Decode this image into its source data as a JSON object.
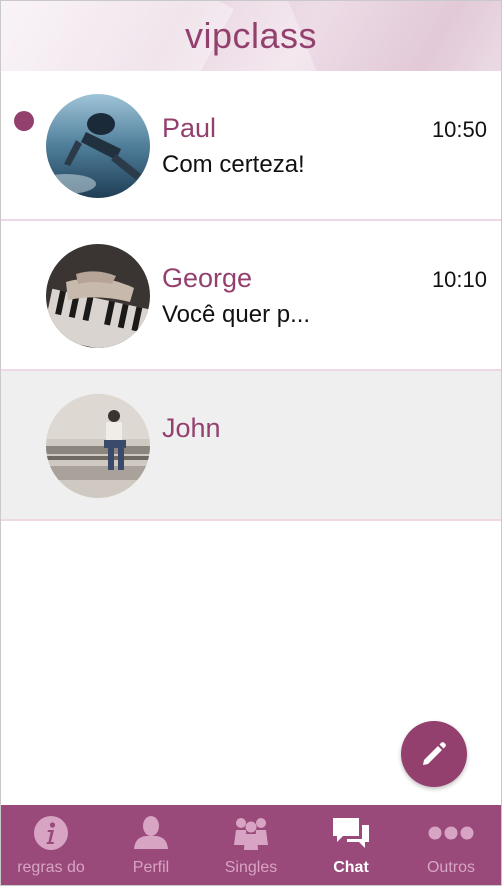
{
  "app": {
    "title": "vipclass"
  },
  "conversations": [
    {
      "name": "Paul",
      "time": "10:50",
      "message": "Com certeza!",
      "unread": true
    },
    {
      "name": "George",
      "time": "10:10",
      "message": "Você quer p...",
      "unread": false
    },
    {
      "name": "John",
      "time": "",
      "message": "",
      "unread": false,
      "selected": true
    }
  ],
  "fab": {
    "icon": "pencil-icon"
  },
  "tabbar": {
    "tabs": [
      {
        "label": "regras do",
        "icon": "info-icon",
        "active": false
      },
      {
        "label": "Perfil",
        "icon": "person-icon",
        "active": false
      },
      {
        "label": "Singles",
        "icon": "group-icon",
        "active": false
      },
      {
        "label": "Chat",
        "icon": "chat-bubbles-icon",
        "active": true
      },
      {
        "label": "Outros",
        "icon": "more-dots-icon",
        "active": false
      }
    ]
  },
  "colors": {
    "accent": "#94406f",
    "tabbar": "#99497a",
    "tab_inactive": "#d8a4c3",
    "divider": "#f0d7e6",
    "selected_row": "#efefef"
  }
}
